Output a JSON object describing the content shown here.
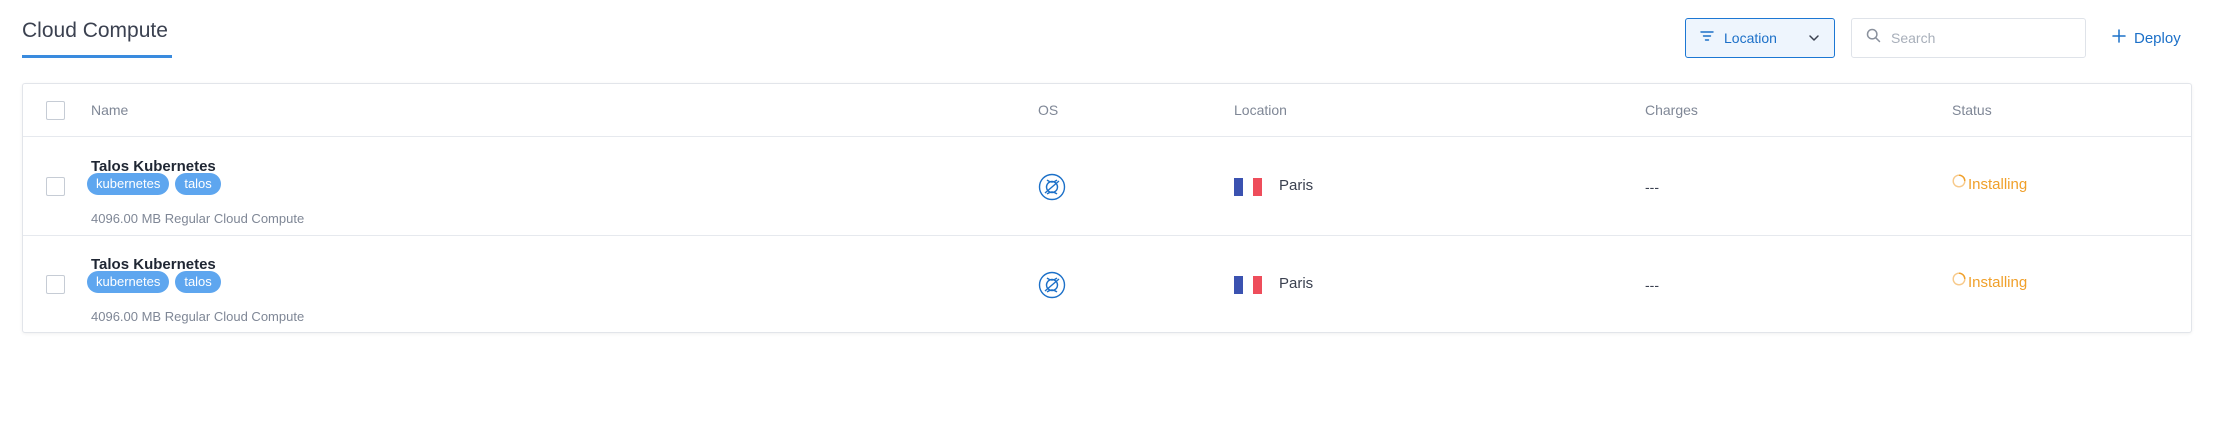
{
  "page": {
    "title": "Cloud Compute"
  },
  "toolbar": {
    "filter_label": "Location",
    "search_placeholder": "Search",
    "deploy_label": "Deploy"
  },
  "table": {
    "columns": {
      "name": "Name",
      "os": "OS",
      "location": "Location",
      "charges": "Charges",
      "status": "Status"
    },
    "rows": [
      {
        "name": "Talos Kubernetes",
        "tags": [
          "kubernetes",
          "talos"
        ],
        "description": "4096.00 MB Regular Cloud Compute",
        "os_icon": "talos-os-icon",
        "location": "Paris",
        "flag": "france-flag",
        "charges": "---",
        "status": "Installing"
      },
      {
        "name": "Talos Kubernetes",
        "tags": [
          "kubernetes",
          "talos"
        ],
        "description": "4096.00 MB Regular Cloud Compute",
        "os_icon": "talos-os-icon",
        "location": "Paris",
        "flag": "france-flag",
        "charges": "---",
        "status": "Installing"
      }
    ]
  },
  "colors": {
    "accent": "#1c70c8",
    "tag_bg": "#5ea6ef",
    "status_installing": "#f0a02a"
  }
}
